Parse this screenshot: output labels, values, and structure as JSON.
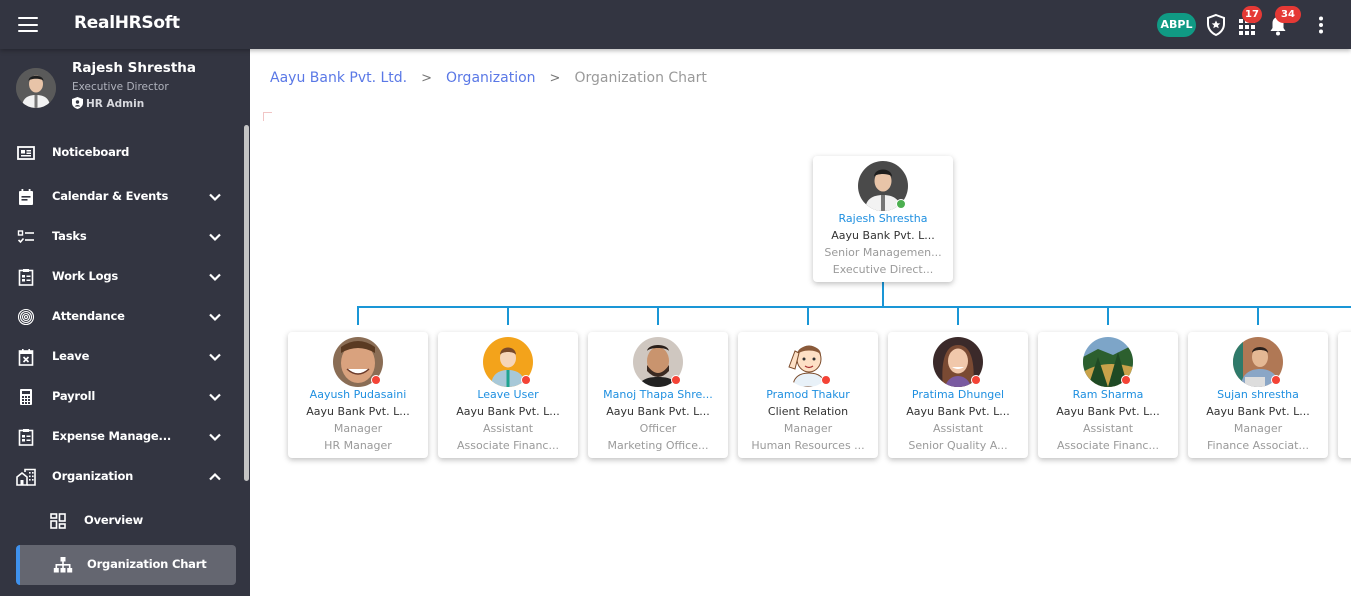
{
  "app": {
    "title": "RealHRSoft"
  },
  "topbar": {
    "company_badge": "ABPL",
    "apps_badge": "17",
    "notifications_badge": "34"
  },
  "profile": {
    "name": "Rajesh Shrestha",
    "role": "Executive Director",
    "access": "HR Admin"
  },
  "sidebar": {
    "items": [
      {
        "label": "Noticeboard",
        "icon": "noticeboard-icon",
        "chevron": "none"
      },
      {
        "label": "Calendar & Events",
        "icon": "calendar-icon",
        "chevron": "down"
      },
      {
        "label": "Tasks",
        "icon": "tasks-icon",
        "chevron": "down"
      },
      {
        "label": "Work Logs",
        "icon": "clipboard-icon",
        "chevron": "down"
      },
      {
        "label": "Attendance",
        "icon": "fingerprint-icon",
        "chevron": "down"
      },
      {
        "label": "Leave",
        "icon": "calendar-x-icon",
        "chevron": "down"
      },
      {
        "label": "Payroll",
        "icon": "calculator-icon",
        "chevron": "down"
      },
      {
        "label": "Expense Manage...",
        "icon": "clipboard-list-icon",
        "chevron": "down"
      },
      {
        "label": "Organization",
        "icon": "building-icon",
        "chevron": "up"
      }
    ],
    "sub_items": [
      {
        "label": "Overview",
        "icon": "dashboard-icon",
        "active": false
      },
      {
        "label": "Organization Chart",
        "icon": "org-chart-icon",
        "active": true
      }
    ]
  },
  "breadcrumb": {
    "items": [
      "Aayu Bank Pvt. Ltd.",
      "Organization"
    ],
    "current": "Organization Chart",
    "separator": ">"
  },
  "colors": {
    "accent_blue": "#1e8fe0",
    "connector": "#1a96d6",
    "status_online": "#4caf50",
    "status_offline": "#f44336",
    "badge_red": "#e53935",
    "company_badge": "#109a84"
  },
  "org_chart": {
    "root": {
      "name": "Rajesh Shrestha",
      "company": "Aayu Bank Pvt. L...",
      "level": "Senior Managemen...",
      "title": "Executive Direct...",
      "status": "online"
    },
    "children": [
      {
        "name": "Aayush Pudasaini",
        "company": "Aayu Bank Pvt. L...",
        "level": "Manager",
        "title": "HR Manager",
        "status": "offline"
      },
      {
        "name": "Leave User",
        "company": "Aayu Bank Pvt. L...",
        "level": "Assistant",
        "title": "Associate Financ...",
        "status": "offline"
      },
      {
        "name": "Manoj Thapa Shre...",
        "company": "Aayu Bank Pvt. L...",
        "level": "Officer",
        "title": "Marketing Office...",
        "status": "offline"
      },
      {
        "name": "Pramod Thakur",
        "company": "Client Relation",
        "level": "Manager",
        "title": "Human Resources ...",
        "status": "offline"
      },
      {
        "name": "Pratima Dhungel",
        "company": "Aayu Bank Pvt. L...",
        "level": "Assistant",
        "title": "Senior Quality A...",
        "status": "offline"
      },
      {
        "name": "Ram Sharma",
        "company": "Aayu Bank Pvt. L...",
        "level": "Assistant",
        "title": "Associate Financ...",
        "status": "offline"
      },
      {
        "name": "Sujan shrestha",
        "company": "Aayu Bank Pvt. L...",
        "level": "Manager",
        "title": "Finance Associat...",
        "status": "offline"
      }
    ]
  }
}
